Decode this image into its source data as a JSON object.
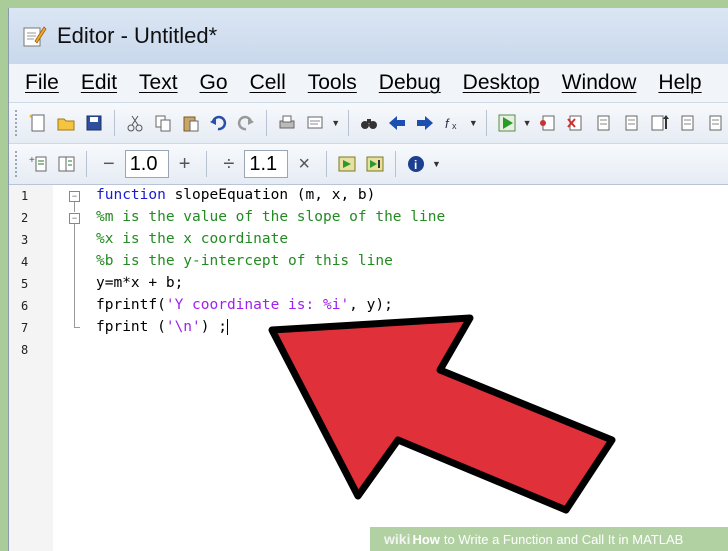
{
  "window": {
    "title": "Editor - Untitled*"
  },
  "menu": [
    "File",
    "Edit",
    "Text",
    "Go",
    "Cell",
    "Tools",
    "Debug",
    "Desktop",
    "Window",
    "Help"
  ],
  "toolbar1": {
    "icons": [
      "new-file-icon",
      "open-folder-icon",
      "save-icon",
      "cut-icon",
      "copy-icon",
      "paste-icon",
      "undo-icon",
      "redo-icon",
      "print-icon",
      "comment-icon",
      "find-icon",
      "back-arrow-icon",
      "forward-arrow-icon",
      "function-icon",
      "run-icon",
      "breakpoint-icon",
      "clear-breakpoint-icon",
      "step-icon",
      "step-in-icon",
      "step-out-icon",
      "continue-icon",
      "exit-debug-icon"
    ]
  },
  "toolbar2": {
    "minus": "−",
    "value1": "1.0",
    "plus": "+",
    "divide": "÷",
    "value2": "1.1",
    "times": "×"
  },
  "editor": {
    "line_numbers": [
      "1",
      "2",
      "3",
      "4",
      "5",
      "6",
      "7",
      "8"
    ],
    "lines": {
      "l1_kw": "function",
      "l1_rest": " slopeEquation (m, x, b)",
      "l2": "%m is the value of the slope of the line",
      "l3": "%x is the x coordinate",
      "l4": "%b is the y-intercept of this line",
      "l5": "y=m*x + b;",
      "l6_pre": "fprintf(",
      "l6_str": "'Y coordinate is: %i'",
      "l6_post": ", y);",
      "l7_pre": "fprint (",
      "l7_str": "'\\n'",
      "l7_post": ") ;"
    }
  },
  "footer": {
    "wiki": "wiki",
    "how": "How",
    "rest": "to Write a Function and Call It in MATLAB"
  },
  "colors": {
    "keyword": "#1a1ad0",
    "comment": "#228b22",
    "string": "#a020f0",
    "arrow": "#e0303a",
    "background": "#a9cc99"
  }
}
